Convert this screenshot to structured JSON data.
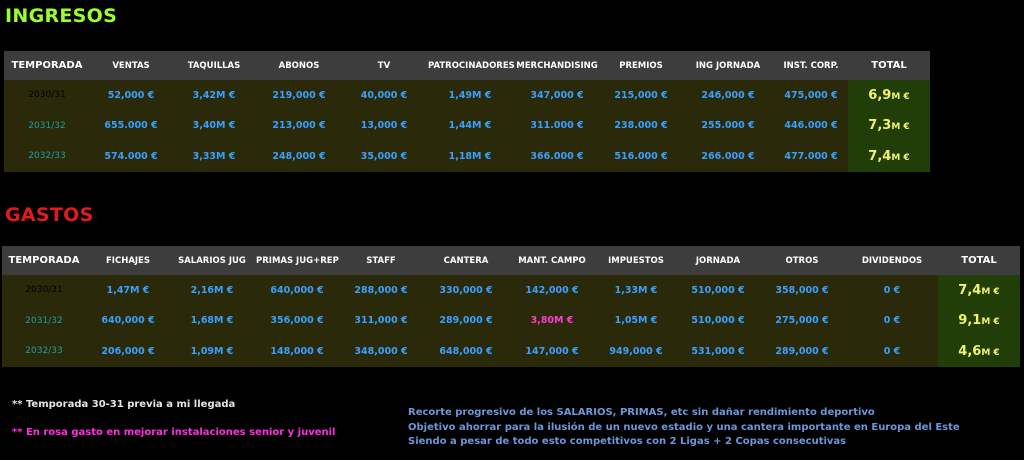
{
  "colors": {
    "income_title": "#9bff2e",
    "expenses_title": "#e11b1b",
    "header_bg": "#3d3d3d",
    "row_bg": "#2a2a0a",
    "total_bg": "#223e08",
    "value_blue": "#3aa0ff",
    "total_yellow": "#f3f36a",
    "season_dark": "#000000",
    "season_teal": "#1e9ea0",
    "highlight_pink": "#ff3ccf",
    "note_pink": "#ff2ee0",
    "summary_text": "#6f96d8"
  },
  "ingresos": {
    "title": "INGRESOS",
    "headers": [
      "TEMPORADA",
      "VENTAS",
      "TAQUILLAS",
      "ABONOS",
      "TV",
      "PATROCINADORES",
      "MERCHANDISING",
      "PREMIOS",
      "ING JORNADA",
      "INST. CORP.",
      "TOTAL"
    ],
    "rows": [
      {
        "season": "2030/31",
        "season_color": "#000000",
        "values": [
          "52,000 €",
          "3,42M €",
          "219,000 €",
          "40,000 €",
          "1,49M €",
          "347,000 €",
          "215,000 €",
          "246,000 €",
          "475,000 €"
        ],
        "total_num": "6,9",
        "total_unit": "M €"
      },
      {
        "season": "2031/32",
        "season_color": "#1e9ea0",
        "values": [
          "655.000 €",
          "3,40M €",
          "213,000 €",
          "13,000 €",
          "1,44M €",
          "311.000 €",
          "238.000 €",
          "255.000 €",
          "446.000 €"
        ],
        "total_num": "7,3",
        "total_unit": "M €"
      },
      {
        "season": "2032/33",
        "season_color": "#1e9ea0",
        "values": [
          "574.000 €",
          "3,33M €",
          "248,000 €",
          "35,000 €",
          "1,18M €",
          "366.000 €",
          "516.000 €",
          "266.000 €",
          "477.000 €"
        ],
        "total_num": "7,4",
        "total_unit": "M €"
      }
    ]
  },
  "gastos": {
    "title": "GASTOS",
    "headers": [
      "TEMPORADA",
      "FICHAJES",
      "SALARIOS JUG",
      "PRIMAS JUG+REP",
      "STAFF",
      "CANTERA",
      "MANT. CAMPO",
      "IMPUESTOS",
      "JORNADA",
      "OTROS",
      "DIVIDENDOS",
      "TOTAL"
    ],
    "rows": [
      {
        "season": "2030/31",
        "season_color": "#000000",
        "values": [
          "1,47M €",
          "2,16M €",
          "640,000 €",
          "288,000 €",
          "330,000 €",
          "142,000 €",
          "1,33M €",
          "510,000 €",
          "358,000 €",
          "0 €"
        ],
        "highlight": [],
        "total_num": "7,4",
        "total_unit": "M €"
      },
      {
        "season": "2031/32",
        "season_color": "#1e9ea0",
        "values": [
          "640,000 €",
          "1,68M €",
          "356,000 €",
          "311,000 €",
          "289,000 €",
          "3,80M €",
          "1,05M €",
          "510,000 €",
          "275,000 €",
          "0 €"
        ],
        "highlight": [
          5
        ],
        "total_num": "9,1",
        "total_unit": "M €"
      },
      {
        "season": "2032/33",
        "season_color": "#1e9ea0",
        "values": [
          "206,000 €",
          "1,09M €",
          "148,000 €",
          "348,000 €",
          "648,000 €",
          "147,000 €",
          "949,000 €",
          "531,000 €",
          "289,000 €",
          "0 €"
        ],
        "highlight": [],
        "total_num": "4,6",
        "total_unit": "M €"
      }
    ]
  },
  "notes": {
    "note1": "** Temporada 30-31 previa a mi llegada",
    "note2": "** En rosa gasto en mejorar instalaciones senior y juvenil",
    "summary": [
      "Recorte progresivo de los SALARIOS, PRIMAS, etc sin dañar rendimiento deportivo",
      "Objetivo ahorrar para la ilusión de un nuevo estadio y una cantera importante en Europa del Este",
      "Siendo a pesar de todo esto competitivos con 2 Ligas + 2 Copas consecutivas"
    ]
  }
}
